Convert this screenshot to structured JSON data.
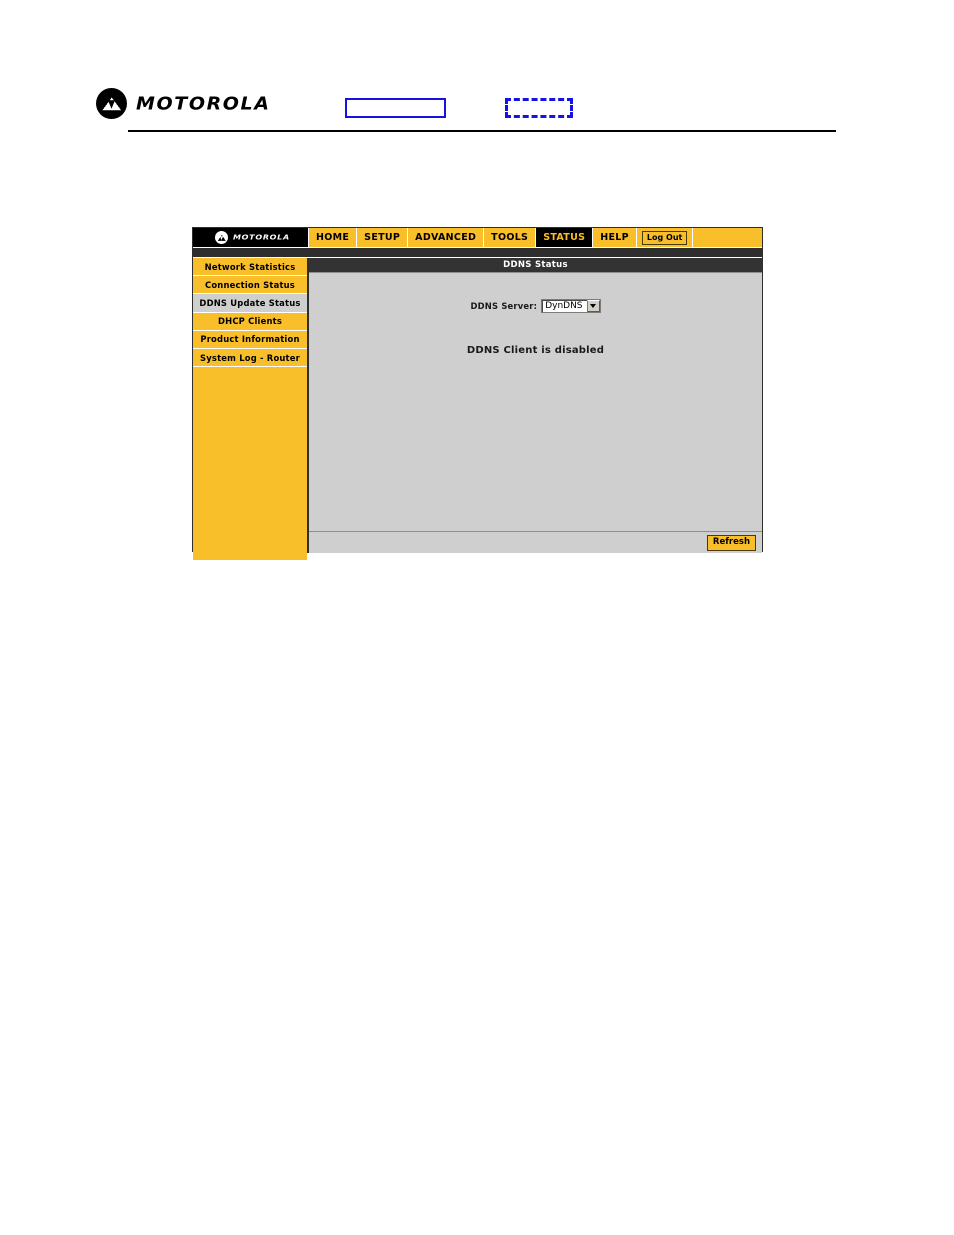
{
  "document_header": {
    "logo_word": "MOTOROLA",
    "logo_icon": "motorola-batwing-icon",
    "placeholder_box_solid": "",
    "placeholder_box_dashed": ""
  },
  "router_ui": {
    "nav": {
      "logo_word": "MOTOROLA",
      "items": [
        {
          "label": "HOME",
          "active": false
        },
        {
          "label": "SETUP",
          "active": false
        },
        {
          "label": "ADVANCED",
          "active": false
        },
        {
          "label": "TOOLS",
          "active": false
        },
        {
          "label": "STATUS",
          "active": true
        },
        {
          "label": "HELP",
          "active": false
        }
      ],
      "logout_label": "Log Out"
    },
    "sidebar": {
      "items": [
        {
          "label": "Network Statistics",
          "selected": false
        },
        {
          "label": "Connection Status",
          "selected": false
        },
        {
          "label": "DDNS Update Status",
          "selected": true
        },
        {
          "label": "DHCP Clients",
          "selected": false
        },
        {
          "label": "Product Information",
          "selected": false
        },
        {
          "label": "System Log - Router",
          "selected": false
        }
      ]
    },
    "content": {
      "title": "DDNS Status",
      "ddns_server_label": "DDNS Server:",
      "ddns_server_value": "DynDNS",
      "ddns_server_options": [
        "DynDNS"
      ],
      "status_message": "DDNS Client is disabled",
      "refresh_label": "Refresh"
    }
  },
  "colors": {
    "motorola_yellow": "#f9bf2a",
    "panel_gray": "#cfcfcf",
    "dark_bar": "#333333",
    "nav_black": "#000000",
    "accent_blue": "#1414e0"
  }
}
